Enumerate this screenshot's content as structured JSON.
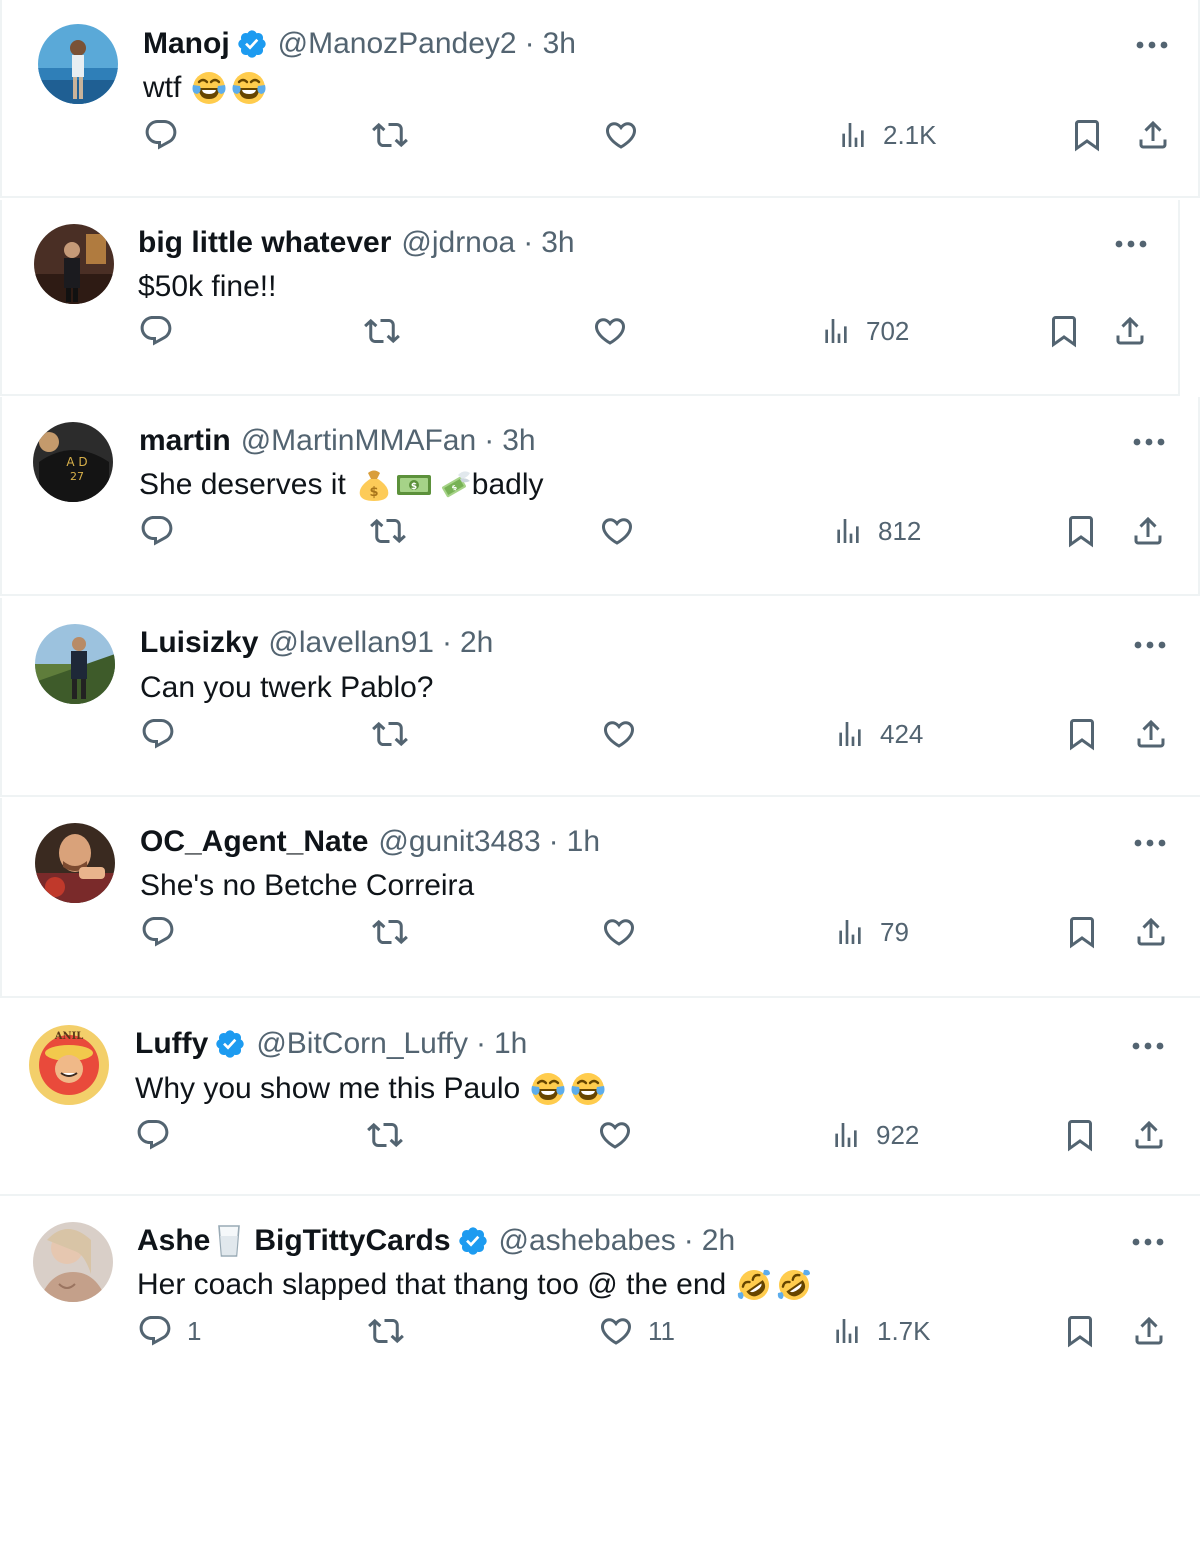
{
  "icons": {
    "reply": "reply-icon",
    "retweet": "retweet-icon",
    "like": "heart-icon",
    "views": "views-icon",
    "bookmark": "bookmark-icon",
    "share": "share-icon",
    "more": "more-icon",
    "verified": "verified-badge-icon"
  },
  "colors": {
    "verified": "#1d9bf0",
    "secondary_text": "#536471",
    "divider": "#eff3f4"
  },
  "posts": [
    {
      "name": "Manoj",
      "verified": true,
      "handle": "@ManozPandey2",
      "separator": "·",
      "time": "3h",
      "text": "wtf",
      "emojis": [
        "face-with-tears-of-joy",
        "face-with-tears-of-joy"
      ],
      "replies": "",
      "likes": "",
      "views": "2.1K"
    },
    {
      "name": "big little whatever",
      "verified": false,
      "handle": "@jdrnoa",
      "separator": "·",
      "time": "3h",
      "text": "$50k fine!!",
      "emojis": [],
      "replies": "",
      "likes": "",
      "views": "702"
    },
    {
      "name": "martin",
      "verified": false,
      "handle": "@MartinMMAFan",
      "separator": "·",
      "time": "3h",
      "text": "She deserves it",
      "emojis": [
        "money-bag",
        "dollar-banknote",
        "money-with-wings"
      ],
      "text_after": "badly",
      "replies": "",
      "likes": "",
      "views": "812"
    },
    {
      "name": "Luisizky",
      "verified": false,
      "handle": "@lavellan91",
      "separator": "·",
      "time": "2h",
      "text": "Can you twerk Pablo?",
      "emojis": [],
      "replies": "",
      "likes": "",
      "views": "424"
    },
    {
      "name": "OC_Agent_Nate",
      "verified": false,
      "handle": "@gunit3483",
      "separator": "·",
      "time": "1h",
      "text": "She's no Betche Correira",
      "emojis": [],
      "replies": "",
      "likes": "",
      "views": "79"
    },
    {
      "name": "Luffy",
      "verified": true,
      "handle": "@BitCorn_Luffy",
      "separator": "·",
      "time": "1h",
      "text": "Why you show me this Paulo",
      "emojis": [
        "face-with-tears-of-joy",
        "face-with-tears-of-joy"
      ],
      "replies": "",
      "likes": "",
      "views": "922"
    },
    {
      "name": "Ashe",
      "name_emoji": "glass-of-milk",
      "name_part2": "BigTittyCards",
      "verified": true,
      "handle": "@ashebabes",
      "separator": "·",
      "time": "2h",
      "text": "Her coach slapped that thang too @ the end",
      "emojis": [
        "rolling-on-the-floor-laughing",
        "rolling-on-the-floor-laughing"
      ],
      "replies": "1",
      "likes": "11",
      "views": "1.7K"
    }
  ]
}
